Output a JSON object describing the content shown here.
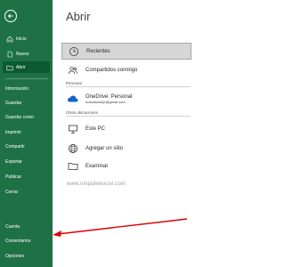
{
  "sidebar": {
    "bg_color": "#1e7145",
    "back_icon": "back-arrow-icon",
    "top_items": [
      {
        "label": "Inicio",
        "icon": "home-icon"
      },
      {
        "label": "Nuevo",
        "icon": "new-file-icon"
      },
      {
        "label": "Abrir",
        "icon": "open-folder-icon"
      }
    ],
    "middle_items": [
      "Información",
      "Guardar",
      "Guardar como",
      "Imprimir",
      "Compartir",
      "Exportar",
      "Publicar",
      "Cerrar"
    ],
    "bottom_items": [
      "Cuenta",
      "Comentarios",
      "Opciones"
    ]
  },
  "main": {
    "title": "Abrir",
    "recent": {
      "label": "Recientes",
      "icon": "clock-icon"
    },
    "shared": {
      "label": "Compartidos conmigo",
      "icon": "shared-people-icon"
    },
    "personal_header": "Personal",
    "onedrive": {
      "label": "OneDrive: Personal",
      "email": "ecavalcantyr@gmail.com",
      "icon": "onedrive-cloud-icon"
    },
    "other_header": "Otras ubicaciones",
    "other_items": [
      {
        "label": "Este PC",
        "icon": "pc-icon"
      },
      {
        "label": "Agregar un sitio",
        "icon": "globe-icon"
      },
      {
        "label": "Examinar",
        "icon": "folder-icon"
      }
    ]
  },
  "watermark": "www.ninjadelexcel.com",
  "annotation_color": "#e00000"
}
